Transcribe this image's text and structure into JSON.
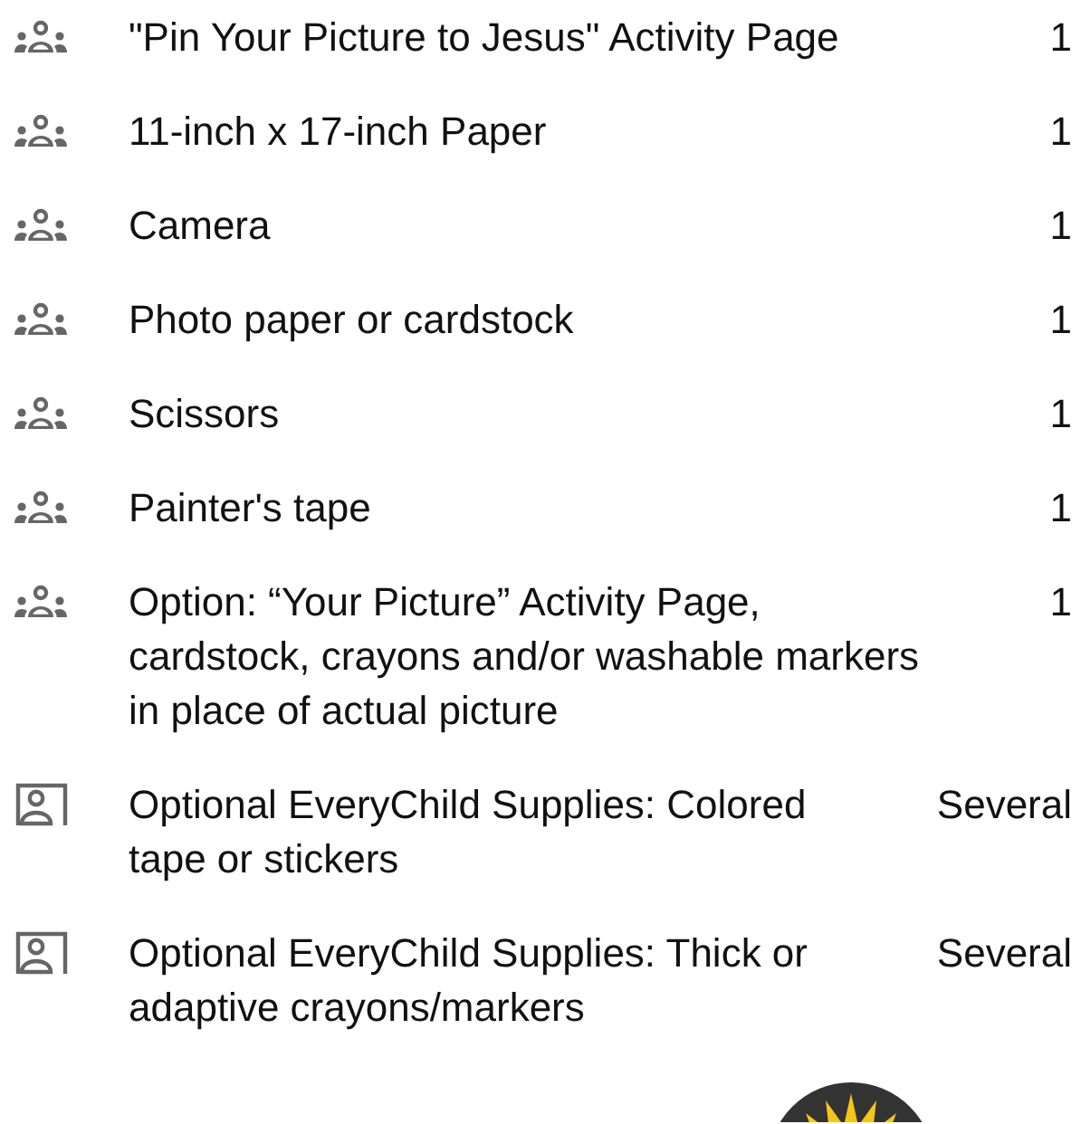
{
  "supplies": [
    {
      "kind": "group",
      "name": "\"Pin Your Picture to Jesus\" Activity Page",
      "quantity": "1"
    },
    {
      "kind": "group",
      "name": "11-inch x 17-inch Paper",
      "quantity": "1"
    },
    {
      "kind": "group",
      "name": "Camera",
      "quantity": "1"
    },
    {
      "kind": "group",
      "name": "Photo paper or cardstock",
      "quantity": "1"
    },
    {
      "kind": "group",
      "name": "Scissors",
      "quantity": "1"
    },
    {
      "kind": "group",
      "name": "Painter's tape",
      "quantity": "1"
    },
    {
      "kind": "group",
      "name": "Option: “Your Picture” Activity Page, cardstock, crayons and/or washable markers in place of actual picture",
      "quantity": "1"
    },
    {
      "kind": "individual",
      "name": "Optional EveryChild Supplies: Colored tape or stickers",
      "quantity": "Several"
    },
    {
      "kind": "individual",
      "name": "Optional EveryChild Supplies: Thick or adaptive crayons/markers",
      "quantity": "Several"
    }
  ]
}
